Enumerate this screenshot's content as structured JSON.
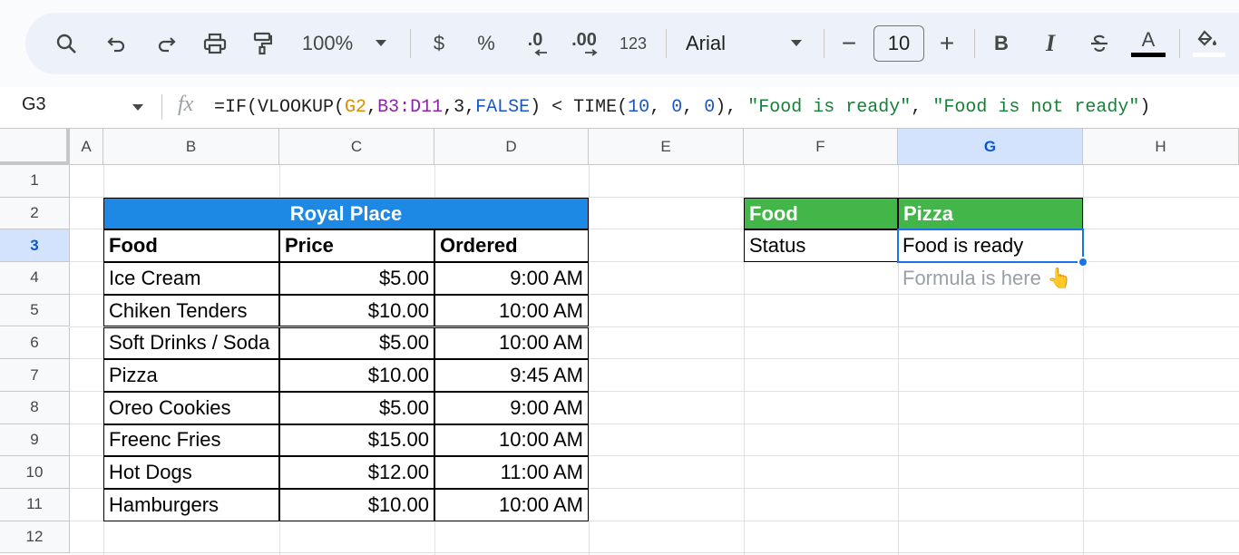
{
  "toolbar": {
    "zoom": "100%",
    "currency": "$",
    "percent": "%",
    "decrease_decimal": ".0",
    "increase_decimal": ".00",
    "number_format": "123",
    "font": "Arial",
    "font_size": "10",
    "minus": "−",
    "plus": "+",
    "bold": "B",
    "italic": "I",
    "text_color": "A",
    "icons": [
      "search-icon",
      "undo-icon",
      "redo-icon",
      "print-icon",
      "paint-format-icon",
      "chevron-down-icon",
      "strikethrough-icon",
      "fill-color-icon"
    ]
  },
  "formula_bar": {
    "name_box": "G3",
    "fx": "fx",
    "formula_parts": {
      "p1": "=IF(VLOOKUP(",
      "p2": "G2",
      "p3": ",",
      "p4": "B3:D11",
      "p5": ",",
      "p6": "3",
      "p7": ",",
      "p8": "FALSE",
      "p9": ") < TIME(",
      "p10": "10",
      "p11": ", ",
      "p12": "0",
      "p13": ", ",
      "p14": "0",
      "p15": "), ",
      "p16": "\"Food is ready\"",
      "p17": ", ",
      "p18": "\"Food is not ready\"",
      "p19": ")"
    }
  },
  "columns": [
    "A",
    "B",
    "C",
    "D",
    "E",
    "F",
    "G",
    "H"
  ],
  "rows": [
    "1",
    "2",
    "3",
    "4",
    "5",
    "6",
    "7",
    "8",
    "9",
    "10",
    "11",
    "12"
  ],
  "table": {
    "title": "Royal Place",
    "headers": [
      "Food",
      "Price",
      "Ordered"
    ],
    "rows": [
      [
        "Ice Cream",
        "$5.00",
        "9:00 AM"
      ],
      [
        "Chiken Tenders",
        "$10.00",
        "10:00 AM"
      ],
      [
        "Soft Drinks / Soda",
        "$5.00",
        "10:00 AM"
      ],
      [
        "Pizza",
        "$10.00",
        "9:45 AM"
      ],
      [
        "Oreo Cookies",
        "$5.00",
        "9:00 AM"
      ],
      [
        "Freenc Fries",
        "$15.00",
        "10:00 AM"
      ],
      [
        "Hot Dogs",
        "$12.00",
        "11:00 AM"
      ],
      [
        "Hamburgers",
        "$10.00",
        "10:00 AM"
      ]
    ]
  },
  "lookup": {
    "label_food": "Food",
    "value_food": "Pizza",
    "label_status": "Status",
    "value_status": "Food is ready",
    "note": "Formula is here 👆"
  },
  "colors": {
    "title_bg": "#1e88e5",
    "green_bg": "#43b64a",
    "selection": "#1a73e8"
  }
}
